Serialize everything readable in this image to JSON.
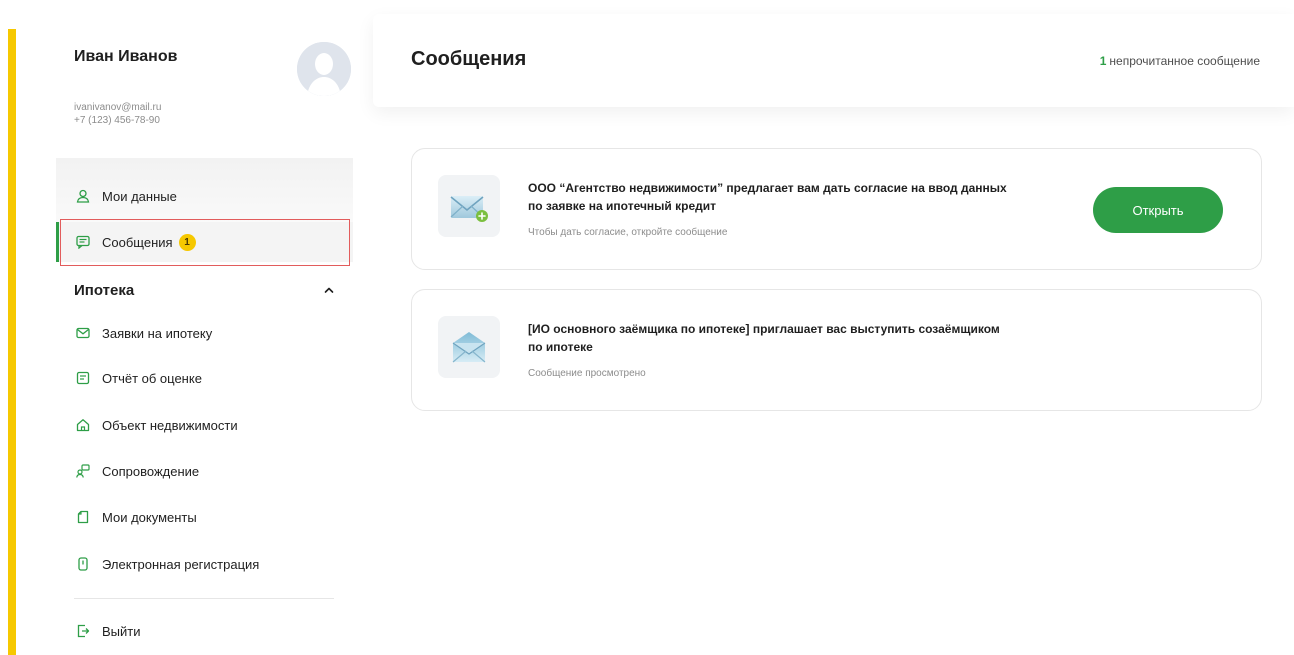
{
  "colors": {
    "accent_yellow": "#f6c800",
    "brand_green": "#2e9e47",
    "highlight_red": "#e25c5c"
  },
  "profile": {
    "name": "Иван Иванов",
    "email": "ivanivanov@mail.ru",
    "phone": "+7 (123) 456-78-90"
  },
  "sidebar": {
    "top_items": [
      {
        "label": "Мои данные",
        "icon": "user-icon"
      },
      {
        "label": "Сообщения",
        "icon": "chat-icon",
        "badge": "1"
      }
    ],
    "section_title": "Ипотека",
    "section_icon": "chevron-up-icon",
    "section_items": [
      {
        "label": "Заявки на ипотеку",
        "icon": "mail-icon"
      },
      {
        "label": "Отчёт об оценке",
        "icon": "report-icon"
      },
      {
        "label": "Объект недвижимости",
        "icon": "home-icon"
      },
      {
        "label": "Сопровождение",
        "icon": "support-icon"
      },
      {
        "label": "Мои документы",
        "icon": "document-icon"
      },
      {
        "label": "Электронная регистрация",
        "icon": "e-registration-icon"
      }
    ],
    "logout": {
      "label": "Выйти",
      "icon": "logout-icon"
    }
  },
  "header": {
    "title": "Сообщения",
    "unread_count": "1",
    "unread_text": "непрочитанное сообщение"
  },
  "messages": [
    {
      "title": "ООО “Агентство недвижимости” предлагает вам дать согласие на ввод данных по заявке на ипотечный кредит",
      "subtitle": "Чтобы дать согласие, откройте сообщение",
      "button": "Открыть",
      "icon": "envelope-add-icon"
    },
    {
      "title": "[ИО основного заёмщика по ипотеке] приглашает вас выступить созаёмщиком по ипотеке",
      "subtitle": "Сообщение просмотрено",
      "icon": "envelope-open-icon"
    }
  ]
}
